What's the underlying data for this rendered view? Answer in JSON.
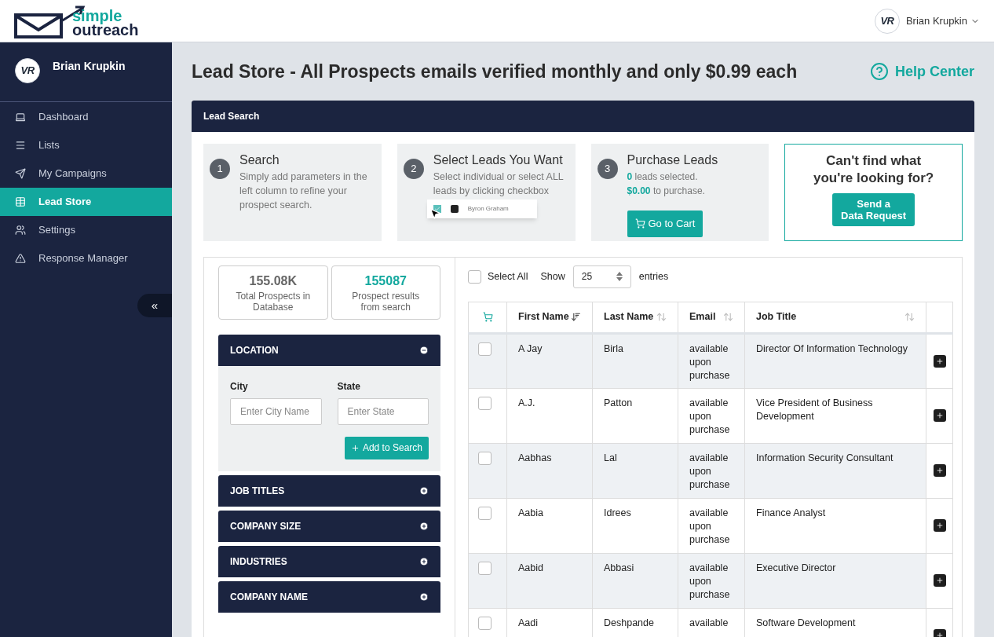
{
  "logo": {
    "line1": "simple",
    "line2": "outreach"
  },
  "user": {
    "name": "Brian Krupkin",
    "avatar": "VR"
  },
  "sidebar": {
    "user_name": "Brian Krupkin",
    "avatar": "VR",
    "collapse": "«",
    "items": [
      {
        "label": "Dashboard",
        "selected": false
      },
      {
        "label": "Lists",
        "selected": false
      },
      {
        "label": "My Campaigns",
        "selected": false
      },
      {
        "label": "Lead Store",
        "selected": true
      },
      {
        "label": "Settings",
        "selected": false
      },
      {
        "label": "Response Manager",
        "selected": false
      }
    ]
  },
  "page_title": "Lead Store - All Prospects emails verified monthly and only $0.99 each",
  "help": "Help Center",
  "panel_title": "Lead Search",
  "steps": [
    {
      "kind": "text",
      "number": "1",
      "title": "Search",
      "text": "Simply add parameters in the left column to refine your prospect search."
    },
    {
      "kind": "demo",
      "number": "2",
      "title": "Select Leads You Want",
      "text": "Select individual or select ALL leads by clicking checkbox",
      "demo_name": "Byron Graham"
    },
    {
      "kind": "cart",
      "number": "3",
      "title": "Purchase Leads",
      "count": "0",
      "count_text": "leads selected.",
      "amount": "$0.00",
      "amount_text": "to purchase.",
      "button": "Go to Cart"
    }
  ],
  "request": {
    "title": "Can't find what you're looking for?",
    "button_line1": "Send a",
    "button_line2": "Data Request"
  },
  "stats": [
    {
      "value": "155.08K",
      "label": "Total Prospects in Database",
      "highlight": false
    },
    {
      "value": "155087",
      "label": "Prospect results from search",
      "highlight": true
    }
  ],
  "filters": [
    {
      "title": "LOCATION",
      "expanded": true,
      "fields": [
        {
          "label": "City",
          "placeholder": "Enter City Name"
        },
        {
          "label": "State",
          "placeholder": "Enter State"
        }
      ],
      "button": "Add to Search"
    },
    {
      "title": "JOB TITLES",
      "expanded": false
    },
    {
      "title": "COMPANY SIZE",
      "expanded": false
    },
    {
      "title": "INDUSTRIES",
      "expanded": false
    },
    {
      "title": "COMPANY NAME",
      "expanded": false
    }
  ],
  "table_controls": {
    "select_all": "Select All",
    "select_all_checked": false,
    "show": "Show",
    "page_size": "25",
    "entries": "entries"
  },
  "columns": [
    {
      "label": "First Name",
      "sorted": true
    },
    {
      "label": "Last Name",
      "sorted": false
    },
    {
      "label": "Email",
      "sorted": false
    },
    {
      "label": "Job Title",
      "sorted": false
    }
  ],
  "rows": [
    {
      "checked": false,
      "first": "A Jay",
      "last": "Birla",
      "email": "available upon purchase",
      "title": "Director Of Information Technology"
    },
    {
      "checked": false,
      "first": "A.J.",
      "last": "Patton",
      "email": "available upon purchase",
      "title": "Vice President of Business Development"
    },
    {
      "checked": false,
      "first": "Aabhas",
      "last": "Lal",
      "email": "available upon purchase",
      "title": "Information Security Consultant"
    },
    {
      "checked": false,
      "first": "Aabia",
      "last": "Idrees",
      "email": "available upon purchase",
      "title": "Finance Analyst"
    },
    {
      "checked": false,
      "first": "Aabid",
      "last": "Abbasi",
      "email": "available upon purchase",
      "title": "Executive Director"
    },
    {
      "checked": false,
      "first": "Aadi",
      "last": "Deshpande",
      "email": "available",
      "title": "Software Development"
    }
  ]
}
